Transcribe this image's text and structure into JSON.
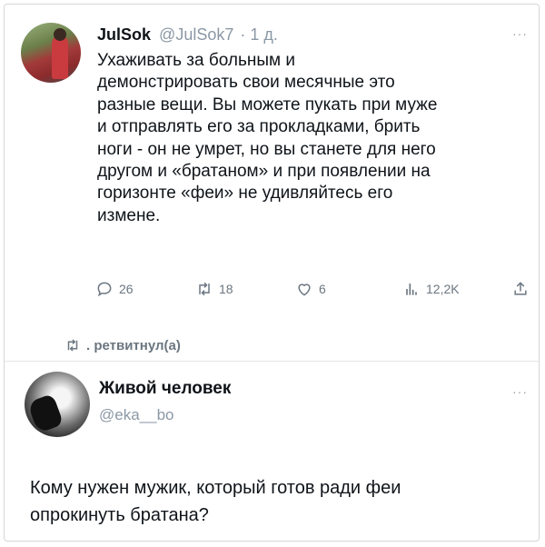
{
  "tweet1": {
    "author_name": "JulSok",
    "author_handle": "@JulSok7",
    "time": "· 1 д.",
    "more": "···",
    "lines": [
      "Ухаживать за больным и",
      "демонстрировать свои месячные это",
      "разные вещи.  Вы можете пукать при муже",
      "и отправлять его за прокладками, брить",
      "ноги - он не умрет, но вы станете для него",
      "другом и «братаном» и при появлении на",
      "горизонте «феи» не удивляйтесь его",
      "измене."
    ],
    "actions": {
      "replies": "26",
      "retweets": "18",
      "likes": "6",
      "views": "12,2K"
    }
  },
  "retweet_label": ". ретвитнул(а)",
  "tweet2": {
    "author_name": "Живой человек",
    "author_handle": "@eka__bo",
    "more": "···",
    "lines": [
      "Кому нужен мужик, который готов ради феи",
      "опрокинуть братана?"
    ]
  },
  "icons": {
    "reply": "reply-icon",
    "retweet": "retweet-icon",
    "like": "heart-icon",
    "views": "views-icon",
    "share": "share-icon"
  },
  "colors": {
    "text": "#0f1419",
    "muted": "#6b7680",
    "handle": "#8b98a5"
  }
}
